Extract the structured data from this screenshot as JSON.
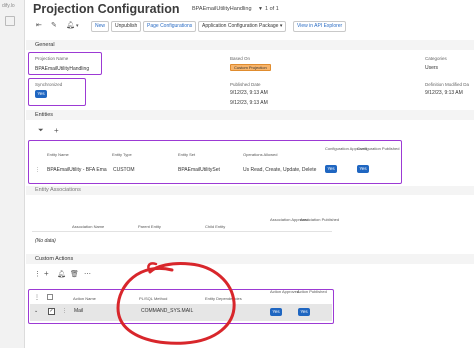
{
  "rail": {
    "text": "dify.lo"
  },
  "header": {
    "title": "Projection Configuration",
    "subtitle": "BPAEmailUtilityHandling",
    "count": "1 of 1"
  },
  "toolbar": {
    "new_label": "New",
    "unpublish_label": "Unpublish",
    "page_configurations_label": "Page Configurations",
    "app_config_package_label": "Application Configuration Package",
    "view_api_explorer_label": "View in API Explorer"
  },
  "general": {
    "title": "General",
    "projection_name_label": "Projection Name",
    "projection_name_value": "BPAEmailUtilityHandling",
    "based_on_label": "Based On",
    "based_on_value": "Custom Projection",
    "categories_label": "Categories",
    "categories_value": "Users",
    "synchronized_label": "Synchronized",
    "synchronized_value": "Yes",
    "published_date_label": "Published Date",
    "published_date_value": "9/12/23, 9:13 AM",
    "definition_modified_label": "Definition Modified Da",
    "definition_modified_value": "9/12/23, 9:13 AM",
    "date_under_based": "9/12/23, 9:13 AM"
  },
  "entities": {
    "title": "Entities",
    "columns": [
      "Entity Name",
      "Entity Type",
      "Entity Set",
      "Operations Allowed",
      "Configuration Approved",
      "Configuration Published"
    ],
    "rows": [
      {
        "name": "BPAEmailUtility - BFA Ema",
        "type": "CUSTOM",
        "set": "BPAEmailUtilitySet",
        "operations": "Us Read, Create, Update, Delete",
        "approved": "Yes",
        "published": "Yes"
      }
    ]
  },
  "entity_associations": {
    "title": "Entity Associations",
    "columns": [
      "Association Name",
      "Parent Entity",
      "Child Entity",
      "Association Approved",
      "Association Published"
    ],
    "empty_text": "(No data)"
  },
  "custom_actions": {
    "title": "Custom Actions",
    "columns": [
      "Action Name",
      "PL/SQL Method",
      "Entity Dependencies",
      "Action Approved",
      "Action Published"
    ],
    "rows": [
      {
        "name": "Mail",
        "method": "COMMAND_SYS.MAIL",
        "dependencies": "",
        "approved": "Yes",
        "published": "Yes"
      }
    ]
  },
  "icons": {
    "back": "back-arrow-icon",
    "edit": "edit-icon",
    "delete": "trash-icon",
    "bell": "bell-icon",
    "filter": "filter-icon",
    "add": "plus-icon",
    "more": "more-vertical-icon"
  },
  "colors": {
    "highlight": "#9c3ad4",
    "annotation": "#d8262b",
    "button_blue": "#1f66c1",
    "badge_orange": "#f7b46b"
  }
}
